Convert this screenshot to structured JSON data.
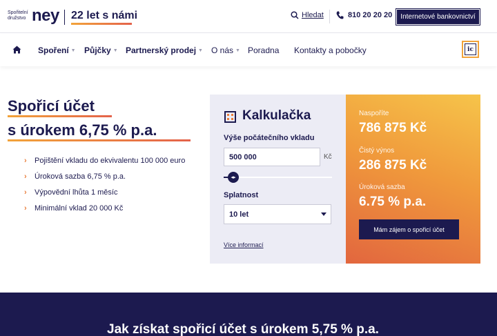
{
  "brand": {
    "small_text_line1": "Spořitelní",
    "small_text_line2": "družstvo",
    "name": "ney",
    "tagline": "22 let s námi"
  },
  "header": {
    "search_label": "Hledat",
    "phone": "810 20 20 20",
    "bank_button": "Internetové bankovnictví"
  },
  "nav": {
    "items": [
      {
        "label": "Spoření",
        "caret": true
      },
      {
        "label": "Půjčky",
        "caret": true
      },
      {
        "label": "Partnerský prodej",
        "caret": true
      },
      {
        "label": "O nás",
        "caret": true
      },
      {
        "label": "Poradna",
        "caret": false
      },
      {
        "label": "Kontakty a pobočky",
        "caret": false
      }
    ],
    "badge": "ic"
  },
  "hero": {
    "title_line1": "Spořicí účet",
    "title_line2": "s úrokem 6,75 % p.a.",
    "bullets": [
      "Pojištění vkladu do ekvivalentu 100 000 euro",
      "Úroková sazba 6,75 % p.a.",
      "Výpovědní lhůta 1 měsíc",
      "Minimální vklad 20 000 Kč"
    ]
  },
  "calculator": {
    "title": "Kalkulačka",
    "amount_label": "Výše počátečního vkladu",
    "amount_value": "500 000",
    "currency": "Kč",
    "slider_fraction": 0.1,
    "term_label": "Splatnost",
    "term_value": "10 let",
    "more_info": "Více informací"
  },
  "results": {
    "saved_label": "Naspoříte",
    "saved_value": "786 875 Kč",
    "net_label": "Čistý výnos",
    "net_value": "286 875 Kč",
    "rate_label": "Úroková sazba",
    "rate_value": "6.75 % p.a.",
    "cta": "Mám zájem o spořicí účet"
  },
  "band": {
    "title": "Jak získat spořicí účet s úrokem 5,75 % p.a."
  },
  "colors": {
    "navy": "#1c1a4f",
    "orange": "#f09a3c",
    "accent": "#e97d3a"
  }
}
